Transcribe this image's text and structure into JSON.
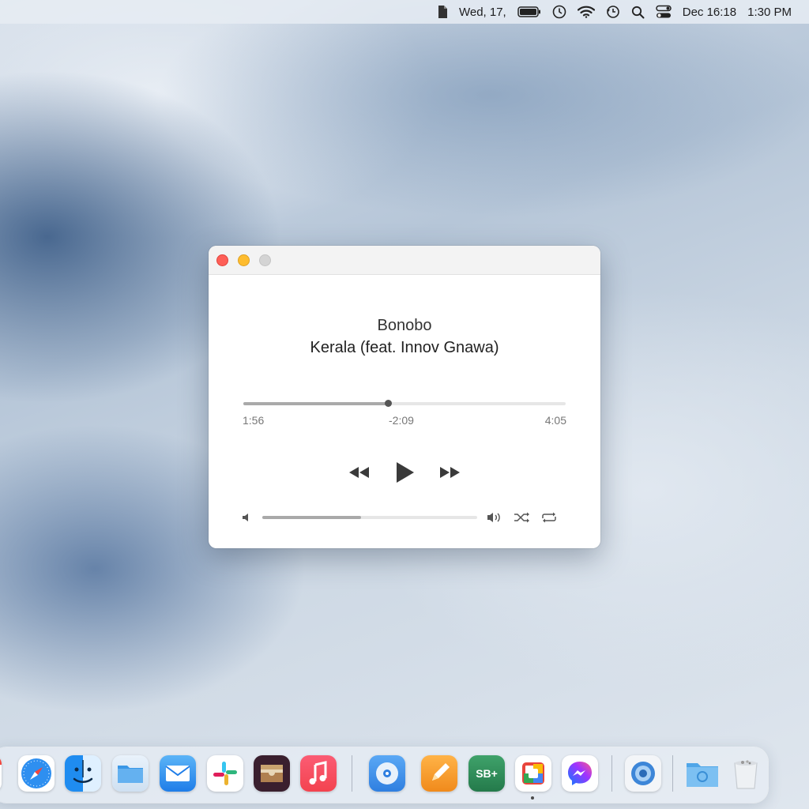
{
  "menubar": {
    "date_short": "Wed, 17,",
    "datetime": "Dec 16:18",
    "time": "1:30 PM",
    "icons": [
      "document-icon",
      "battery-icon",
      "clock-icon",
      "wifi-icon",
      "time-machine-icon",
      "search-icon",
      "control-center-icon"
    ]
  },
  "player": {
    "artist": "Bonobo",
    "track": "Kerala (feat. Innov Gnawa)",
    "elapsed": "1:56",
    "remaining": "-2:09",
    "total": "4:05",
    "progress_fraction": 0.448,
    "volume_fraction": 0.46,
    "window_buttons": [
      "close",
      "minimize",
      "zoom"
    ]
  },
  "dock": {
    "apps": [
      "calendar",
      "safari",
      "finder",
      "files",
      "mail",
      "slack",
      "wallet",
      "music",
      "disk-utility",
      "pages",
      "sb-plus",
      "photos-app",
      "messenger",
      "browser",
      "folder",
      "trash"
    ],
    "sb_plus_label": "SB+"
  },
  "colors": {
    "close": "#fe5f57",
    "minimize": "#febc2e",
    "zoom": "#d4d4d4",
    "music_red": "#f3434f"
  }
}
